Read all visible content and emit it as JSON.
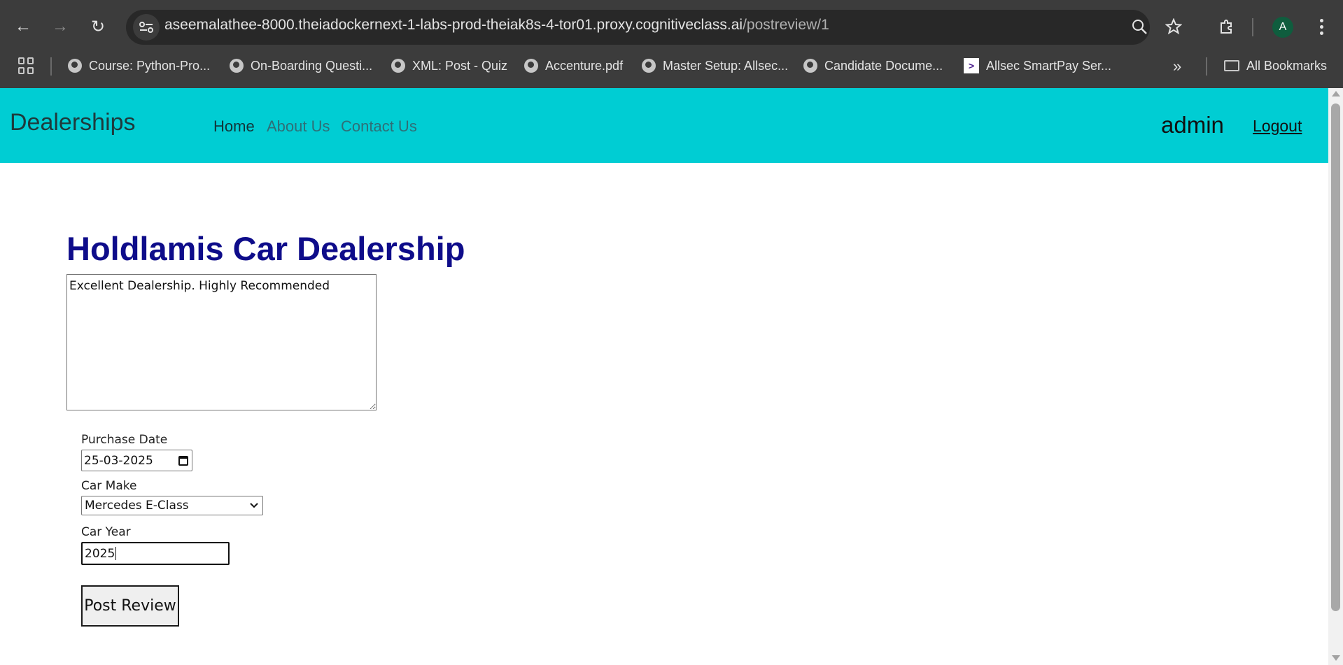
{
  "browser": {
    "url_host": "aseemalathee-8000.theiadockernext-1-labs-prod-theiak8s-4-tor01.proxy.cognitiveclass.ai",
    "url_path": "/postreview/1",
    "profile_initial": "A",
    "bookmarks": [
      {
        "label": "Course: Python-Pro...",
        "icon": "globe-icon"
      },
      {
        "label": "On-Boarding Questi...",
        "icon": "globe-icon"
      },
      {
        "label": "XML: Post - Quiz",
        "icon": "globe-icon"
      },
      {
        "label": "Accenture.pdf",
        "icon": "globe-icon"
      },
      {
        "label": "Master Setup: Allsec...",
        "icon": "globe-icon"
      },
      {
        "label": "Candidate Docume...",
        "icon": "globe-icon"
      },
      {
        "label": "Allsec SmartPay Ser...",
        "icon": "allsec-logo-icon"
      }
    ],
    "all_bookmarks_label": "All Bookmarks"
  },
  "navbar": {
    "brand": "Dealerships",
    "links": [
      "Home",
      "About Us",
      "Contact Us"
    ],
    "username": "admin",
    "logout_label": "Logout",
    "background": "#00cdd3"
  },
  "review": {
    "dealer_name": "Holdlamis Car Dealership",
    "review_text": "Excellent Dealership. Highly Recommended",
    "purchase_date_label": "Purchase Date",
    "purchase_date_value": "25-03-2025",
    "car_make_label": "Car Make",
    "car_make_selected": "Mercedes E-Class",
    "car_year_label": "Car Year",
    "car_year_value": "2025",
    "submit_label": "Post Review",
    "title_color": "#0e0c8a"
  }
}
